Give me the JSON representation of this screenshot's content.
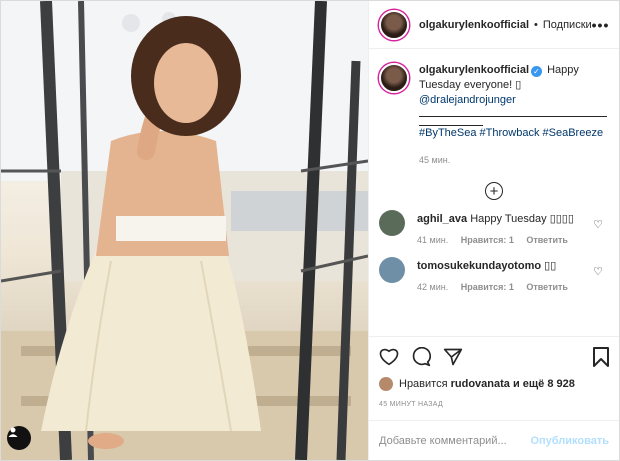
{
  "header": {
    "username": "olgakurylenkoofficial",
    "separator": "•",
    "follow_label": "Подписки",
    "more_label": "•••"
  },
  "caption": {
    "username": "olgakurylenkoofficial",
    "text": "Happy Tuesday everyone! ",
    "glyph": "▯",
    "mention": "@dralejandrojunger",
    "hashtags": [
      "#ByTheSea",
      "#Throwback",
      "#SeaBreeze"
    ],
    "time": "45 мин."
  },
  "comments": [
    {
      "username": "aghil_ava",
      "text": "Happy Tuesday ▯▯▯▯",
      "time": "41 мин.",
      "likes": "Нравится: 1",
      "reply": "Ответить",
      "avatar_color": "#5b6b5a"
    },
    {
      "username": "tomosukekundayotomo",
      "text": "▯▯",
      "time": "42 мин.",
      "likes": "Нравится: 1",
      "reply": "Ответить",
      "avatar_color": "#6f8fa6"
    }
  ],
  "likes": {
    "prefix": "Нравится",
    "user": "rudovanata",
    "suffix": "и ещё 8 928"
  },
  "timestamp": "45 МИНУТ НАЗАД",
  "add_comment": {
    "placeholder": "Добавьте комментарий...",
    "publish_label": "Опубликовать"
  },
  "colors": {
    "accent": "#3897f0",
    "publish_disabled": "#b2dffc",
    "muted": "#8e8e8e"
  }
}
